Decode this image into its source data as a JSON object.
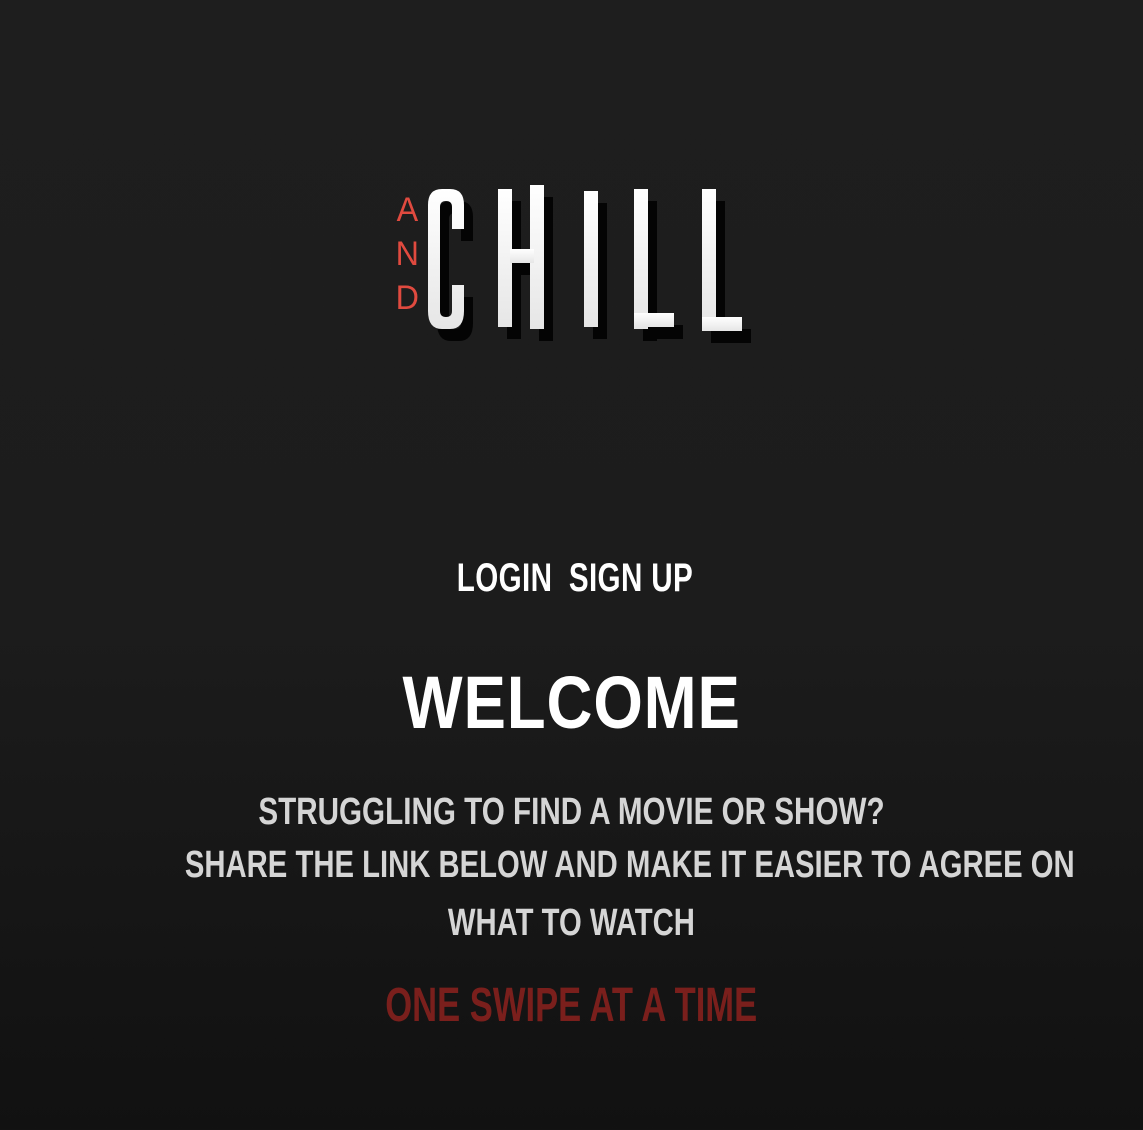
{
  "logo": {
    "small": "AND",
    "letters": [
      "A",
      "N",
      "D"
    ],
    "word": "CHILL"
  },
  "nav": {
    "login_label": "LOGIN",
    "signup_label": "SIGN UP"
  },
  "welcome": {
    "title": "WELCOME"
  },
  "copy": {
    "line1": "STRUGGLING TO FIND A MOVIE OR SHOW?",
    "line2a": "SHARE THE LINK BELOW AND MAKE IT EASIER TO AGREE ON",
    "line2b": "WHAT TO WATCH"
  },
  "tagline": "ONE SWIPE AT A TIME",
  "colors": {
    "background": "#1e1e1e",
    "accent_red": "#e04a3f",
    "tagline_red": "#7a1f1c",
    "text_white": "#ffffff",
    "text_grey": "#d5d5d5"
  }
}
